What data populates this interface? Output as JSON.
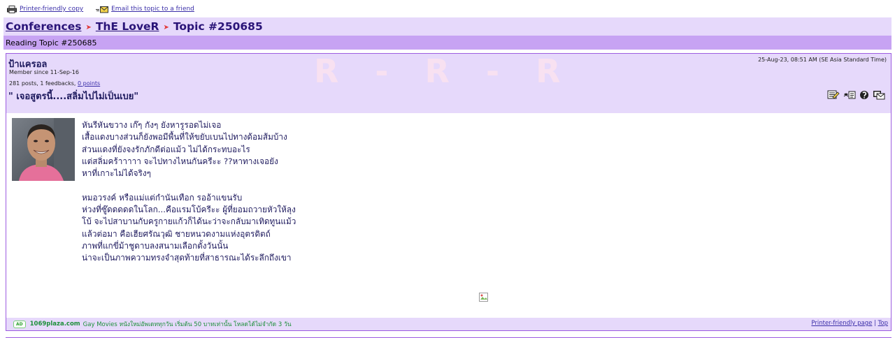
{
  "top_links": {
    "printer_friendly": "Printer-friendly copy",
    "email_topic": "Email this topic to a friend"
  },
  "breadcrumb": {
    "conferences": "Conferences",
    "forum": "ThE LoveR",
    "topic": "Topic #250685",
    "separator": "➤"
  },
  "reading_bar": {
    "text": "Reading Topic #250685"
  },
  "post": {
    "watermark": "R  -  R  -  R",
    "author": "ป้าแครอล",
    "member_since": "Member since 11-Sep-16",
    "stats_prefix": "281 posts,  1 feedbacks,  ",
    "points": "0 points",
    "title": "\" เจอสูตรนี้....สลิ่มไปไม่เป็นเบย\"",
    "date": "25-Aug-23, 08:51 AM (SE Asia Standard Time)",
    "body_lines": [
      "หันรีหันขวาง เก๊ๆ กังๆ ยังหารูรอดไม่เจอ",
      "เสื้อแดงบางส่วนก็ยังพอมีพื้นที่ให้ขยับเบนไปทางด้อมส้มบ้าง",
      "ส่วนแดงที่ยังจงรักภักดีต่อแม้ว ไม่ได้กระทบอะไร",
      "แต่สลิ่มคร้าาาาา จะไปทางไหนกันครีะะ ??หาทางเจอยัง",
      "หาที่เกาะไม่ได้จริงๆ",
      "",
      "หมอวรงค์ หรือแม่แต่กำนันเทือก รออ้าแขนรับ",
      "ห่วงที่ซู๊ดดดดดในโลก...คือแรมโบ้ครีะะ ผู้ที่ยอมถวายหัวให้ลุง",
      "โบ้ จะไปสาบานกับครูกายแก้วก็ได้นะว่าจะกลับมาเทิดทูนแม้ว",
      "แล้วต่อมา คือเฮียศรัณวุฒิ ชายหนวดงามแห่งอุตรดิตถ์",
      "ภาพที่แกขี่ม้าชูดาบลงสนามเลือกตั้งวันนั้น",
      "น่าจะเป็นภาพความทรงจำสุดท้ายที่สาธารณะได้ระลึกถึงเขา"
    ]
  },
  "footer": {
    "ad_badge": "AD",
    "ad_site": "1069plaza.com",
    "ad_desc": "Gay Movies หนังใหม่อัพเดททุกวัน เริ่มต้น 50 บาทเท่านั้น โหลดได้ไม่จำกัด 3 วัน",
    "printer_page": "Printer-friendly page",
    "separator": " | ",
    "top": "Top"
  },
  "colors": {
    "breadcrumb_bg": "#e6d9fb",
    "reading_bar_bg": "#c7a3f3",
    "border": "#9c5ce0",
    "text_dark": "#1e1a5e",
    "link": "#3a2ea8",
    "arrow": "#e23a3a",
    "ad_green": "#1d8f3a"
  },
  "icons": {
    "printer": "printer-icon",
    "email": "email-icon",
    "reply": "reply-icon",
    "quote": "quote-icon",
    "alert": "alert-icon",
    "message": "message-icon",
    "broken_image": "broken-image-icon"
  }
}
